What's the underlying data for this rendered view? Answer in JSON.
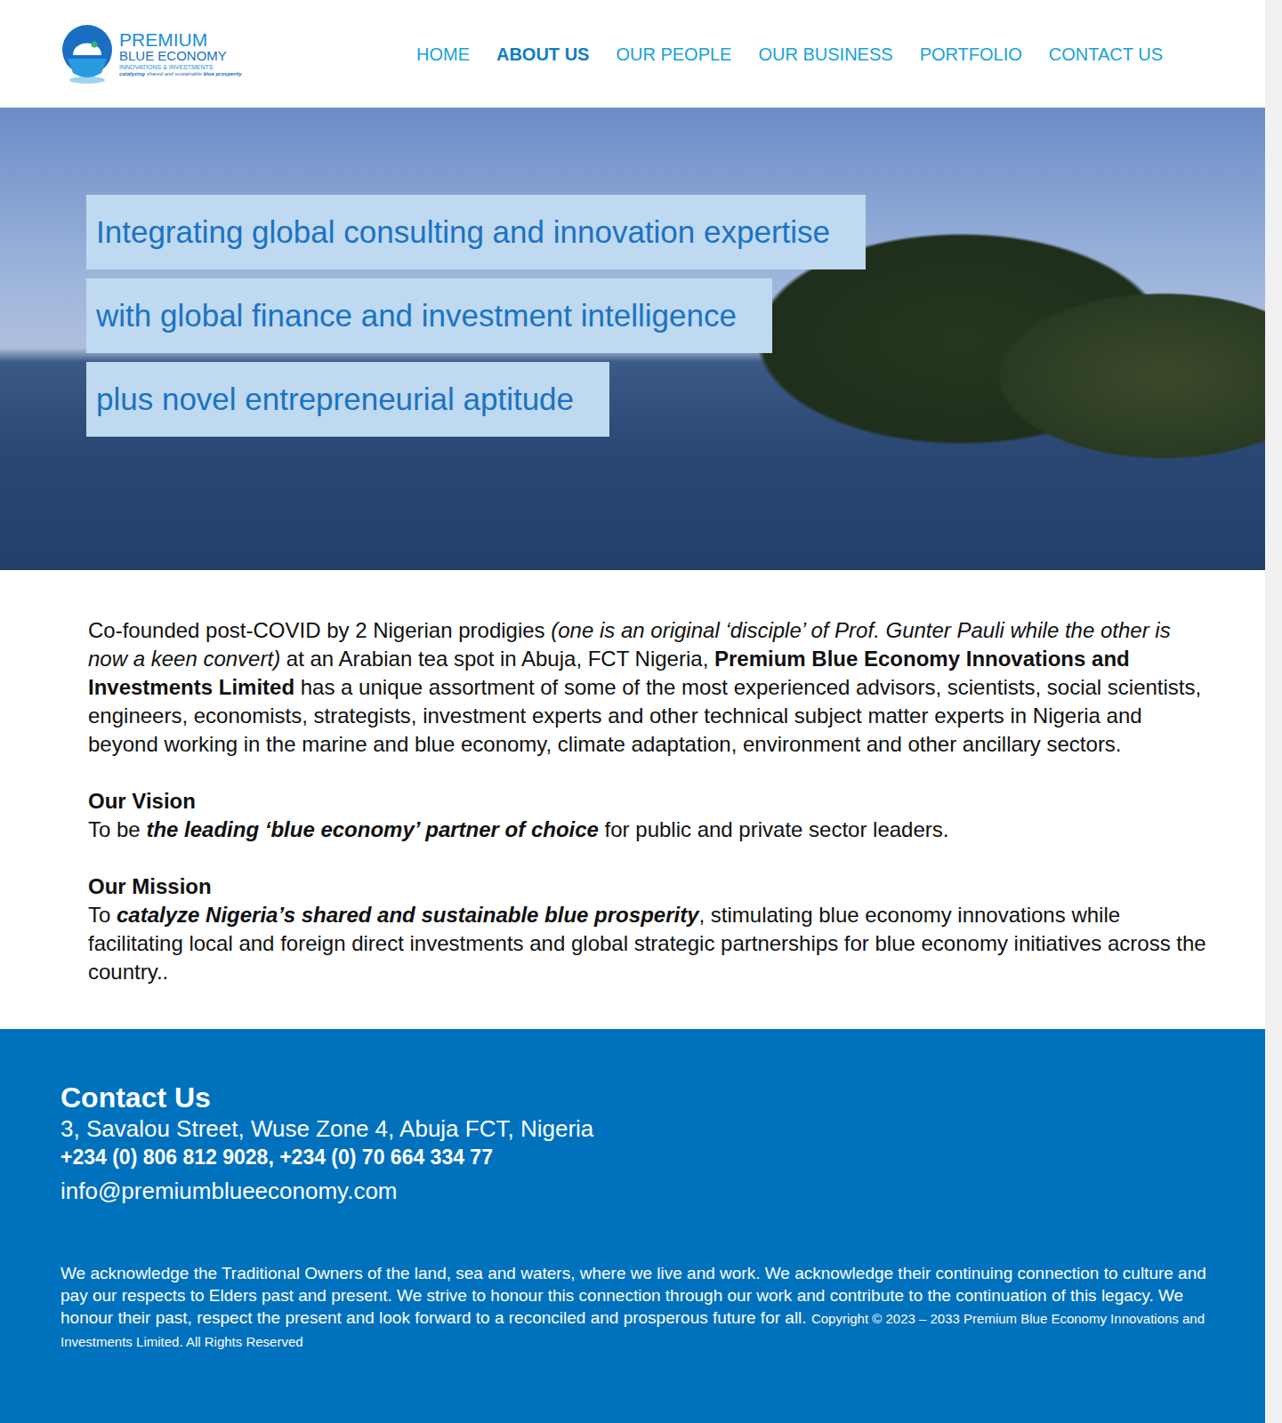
{
  "logo": {
    "line1": "PREMIUM",
    "line2": "BLUE ECONOMY",
    "line3": "INNOVATIONS & INVESTMENTS",
    "tagline": [
      {
        "text": "catalyzing",
        "kind": "bold-italic"
      },
      {
        "text": " shared and sustainable ",
        "kind": "italic"
      },
      {
        "text": "blue prosperity",
        "kind": "bold-italic"
      }
    ]
  },
  "nav": [
    {
      "label": "HOME",
      "selected": false
    },
    {
      "label": "ABOUT US",
      "selected": true
    },
    {
      "label": "OUR PEOPLE",
      "selected": false
    },
    {
      "label": "OUR BUSINESS",
      "selected": false
    },
    {
      "label": "PORTFOLIO",
      "selected": false
    },
    {
      "label": "CONTACT US",
      "selected": false
    }
  ],
  "hero": {
    "lines": [
      "Integrating global consulting and innovation expertise",
      "with global finance and investment intelligence",
      "plus novel entrepreneurial aptitude"
    ]
  },
  "intro": {
    "segments": [
      {
        "text": "Co-founded post-COVID by 2 Nigerian prodigies ",
        "kind": "plain"
      },
      {
        "text": "(one is an original ‘disciple’ of Prof. Gunter Pauli while the other is now a keen convert)",
        "kind": "italic"
      },
      {
        "text": " at an Arabian tea spot in Abuja, FCT Nigeria, ",
        "kind": "plain"
      },
      {
        "text": "Premium Blue Economy Innovations and Investments Limited",
        "kind": "bold"
      },
      {
        "text": " has a unique assortment of some of the most experienced advisors, scientists, social scientists, engineers, economists, strategists, investment experts and other technical subject matter experts in Nigeria and beyond working in the marine and blue economy, climate adaptation, environment and other ancillary sectors.",
        "kind": "plain"
      }
    ]
  },
  "vision": {
    "title": "Our Vision",
    "segments": [
      {
        "text": "To be ",
        "kind": "plain"
      },
      {
        "text": "the leading ‘blue economy’ partner of choice",
        "kind": "bold-italic"
      },
      {
        "text": " for public and private sector leaders.",
        "kind": "plain"
      }
    ]
  },
  "mission": {
    "title": "Our Mission",
    "segments": [
      {
        "text": "To ",
        "kind": "plain"
      },
      {
        "text": "catalyze Nigeria’s shared and sustainable blue prosperity",
        "kind": "bold-italic"
      },
      {
        "text": ", stimulating blue economy innovations while facilitating local and foreign direct investments and global strategic partnerships for blue economy initiatives across the country..",
        "kind": "plain"
      }
    ]
  },
  "footer": {
    "title": "Contact Us",
    "address": "3, Savalou Street, Wuse Zone 4, Abuja FCT, Nigeria",
    "phones": "+234 (0) 806 812 9028, +234 (0) 70 664 334 77",
    "email": "info@premiumblueeconomy.com",
    "acknowledgement": "We acknowledge the Traditional Owners of the land, sea and waters, where we live and work. We acknowledge their continuing connection to culture and pay our respects to Elders past and present. We strive to honour this connection through our work and contribute to the continuation of this legacy. We honour their past, respect the present and look forward to a reconciled and prosperous future for all.",
    "copyright": "Copyright © 2023 – 2033 Premium Blue Economy Innovations and Investments Limited. All Rights Reserved"
  }
}
